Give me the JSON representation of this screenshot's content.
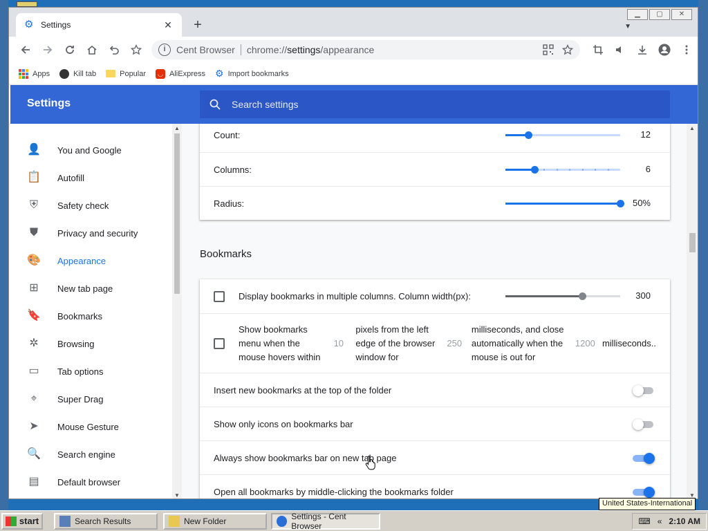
{
  "browser": {
    "tab_title": "Settings",
    "tab_close": "✕",
    "new_tab": "+",
    "site_name": "Cent Browser",
    "url_prefix": "chrome://",
    "url_path": "settings",
    "url_suffix": "/appearance"
  },
  "bookmarks_bar": {
    "items": [
      {
        "label": "Apps"
      },
      {
        "label": "Kill tab"
      },
      {
        "label": "Popular"
      },
      {
        "label": "AliExpress"
      },
      {
        "label": "Import bookmarks"
      }
    ]
  },
  "settings": {
    "title": "Settings",
    "search_placeholder": "Search settings"
  },
  "sidebar": {
    "items": [
      {
        "label": "You and Google",
        "icon": "person-icon"
      },
      {
        "label": "Autofill",
        "icon": "clipboard-icon"
      },
      {
        "label": "Safety check",
        "icon": "shield-check-icon"
      },
      {
        "label": "Privacy and security",
        "icon": "shield-icon"
      },
      {
        "label": "Appearance",
        "icon": "palette-icon",
        "active": true
      },
      {
        "label": "New tab page",
        "icon": "new-tab-icon"
      },
      {
        "label": "Bookmarks",
        "icon": "bookmark-icon"
      },
      {
        "label": "Browsing",
        "icon": "browsing-icon"
      },
      {
        "label": "Tab options",
        "icon": "tab-icon"
      },
      {
        "label": "Super Drag",
        "icon": "drag-icon"
      },
      {
        "label": "Mouse Gesture",
        "icon": "pointer-icon"
      },
      {
        "label": "Search engine",
        "icon": "search-icon"
      },
      {
        "label": "Default browser",
        "icon": "browser-icon"
      }
    ]
  },
  "top_card": {
    "rows": [
      {
        "label": "Count:",
        "value": "12",
        "fraction": 0.2
      },
      {
        "label": "Columns:",
        "value": "6",
        "fraction": 0.25
      },
      {
        "label": "Radius:",
        "value": "50%",
        "fraction": 1.0
      }
    ]
  },
  "bookmarks_section": {
    "title": "Bookmarks",
    "column_row": {
      "label": "Display bookmarks in multiple columns. Column width(px):",
      "value": "300",
      "fraction": 0.67
    },
    "hover_row": {
      "seg1": "Show bookmarks menu when the mouse hovers within",
      "num1": "10",
      "seg2": "pixels from the left edge of the browser window for",
      "num2": "250",
      "seg3": "milliseconds, and close automatically when the mouse is out for",
      "num3": "1200",
      "seg4": "milliseconds.."
    },
    "toggles": [
      {
        "label": "Insert new bookmarks at the top of the folder",
        "on": false
      },
      {
        "label": "Show only icons on bookmarks bar",
        "on": false
      },
      {
        "label": "Always show bookmarks bar on new tab page",
        "on": true
      },
      {
        "label": "Open all bookmarks by middle-clicking the bookmarks folder",
        "on": true
      }
    ]
  },
  "taskbar": {
    "start": "start",
    "tasks": [
      {
        "label": "Search Results"
      },
      {
        "label": "New Folder"
      },
      {
        "label": "Settings - Cent Browser"
      }
    ],
    "tray_arrow": "«",
    "clock": "2:10 AM",
    "tooltip": "United States-International"
  },
  "colors": {
    "accent": "#1a73e8",
    "header": "#3367d6"
  }
}
